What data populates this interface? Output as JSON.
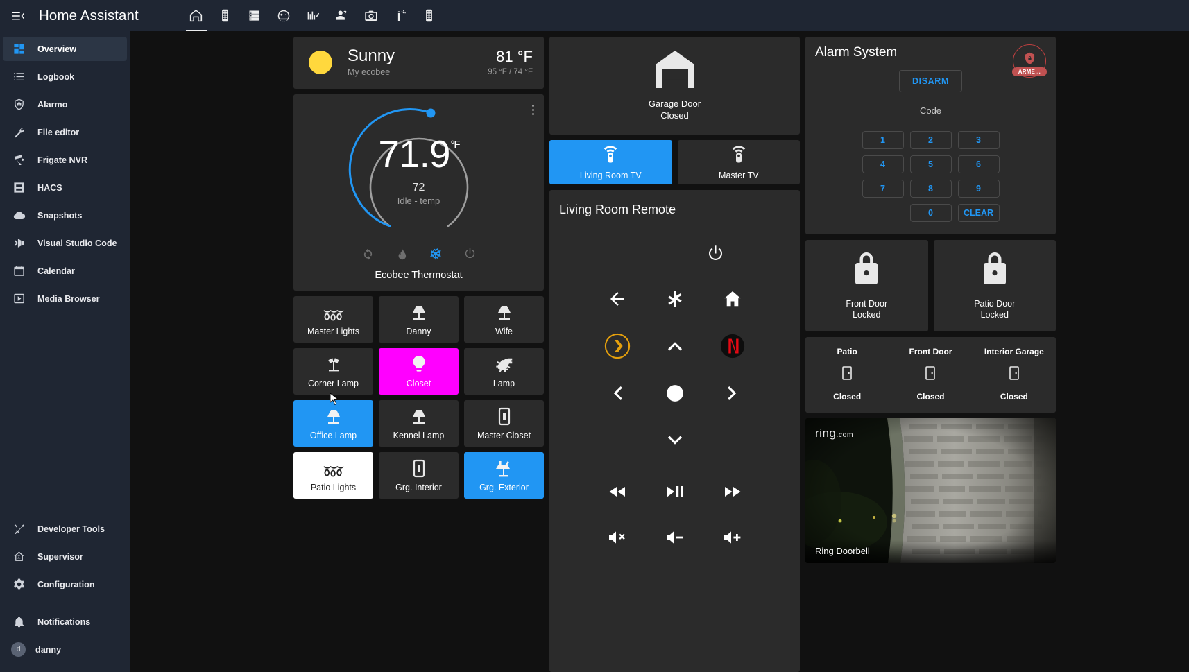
{
  "app": {
    "title": "Home Assistant",
    "menu_icon": "menu-collapse-icon"
  },
  "tabs": [
    {
      "name": "home",
      "icon": "home-icon",
      "active": true
    },
    {
      "name": "remote",
      "icon": "remote-control-icon",
      "active": false
    },
    {
      "name": "server",
      "icon": "server-rack-icon",
      "active": false
    },
    {
      "name": "robot",
      "icon": "robot-vacuum-icon",
      "active": false
    },
    {
      "name": "history",
      "icon": "chart-timeline-icon",
      "active": false
    },
    {
      "name": "presence",
      "icon": "account-question-icon",
      "active": false
    },
    {
      "name": "cameras",
      "icon": "camera-icon",
      "active": false
    },
    {
      "name": "sensors",
      "icon": "antenna-signal-icon",
      "active": false
    },
    {
      "name": "devices",
      "icon": "remote-control-icon",
      "active": false
    }
  ],
  "sidebar": {
    "items": [
      {
        "label": "Overview",
        "icon": "view-dashboard-icon",
        "active": true
      },
      {
        "label": "Logbook",
        "icon": "format-list-icon",
        "active": false
      },
      {
        "label": "Alarmo",
        "icon": "shield-home-icon",
        "active": false
      },
      {
        "label": "File editor",
        "icon": "wrench-icon",
        "active": false
      },
      {
        "label": "Frigate NVR",
        "icon": "cctv-icon",
        "active": false
      },
      {
        "label": "HACS",
        "icon": "hacs-icon",
        "active": false
      },
      {
        "label": "Snapshots",
        "icon": "cloud-icon",
        "active": false
      },
      {
        "label": "Visual Studio Code",
        "icon": "vscode-icon",
        "active": false
      },
      {
        "label": "Calendar",
        "icon": "calendar-icon",
        "active": false
      },
      {
        "label": "Media Browser",
        "icon": "play-box-icon",
        "active": false
      }
    ],
    "bottom_items": [
      {
        "label": "Developer Tools",
        "icon": "hammer-wrench-icon"
      },
      {
        "label": "Supervisor",
        "icon": "home-assistant-icon"
      },
      {
        "label": "Configuration",
        "icon": "cog-icon"
      }
    ],
    "notifications": {
      "label": "Notifications",
      "icon": "bell-icon"
    },
    "user": {
      "label": "danny",
      "initial": "d"
    }
  },
  "weather": {
    "state": "Sunny",
    "name": "My ecobee",
    "temperature": "81 °F",
    "high_low": "95 °F / 74 °F",
    "icon": "sunny-icon"
  },
  "thermostat": {
    "current": "71.9",
    "unit": "°F",
    "target": "72",
    "status": "Idle - temp",
    "name": "Ecobee Thermostat",
    "dial_color": "#2196f3",
    "modes": [
      {
        "name": "auto",
        "icon": "autorenew-icon",
        "active": false
      },
      {
        "name": "heat",
        "icon": "fire-icon",
        "active": false
      },
      {
        "name": "cool",
        "icon": "snowflake-icon",
        "active": true
      },
      {
        "name": "off",
        "icon": "power-icon",
        "active": false
      }
    ]
  },
  "light_tiles": [
    {
      "label": "Master Lights",
      "icon": "string-lights-icon",
      "state": "off"
    },
    {
      "label": "Danny",
      "icon": "lamp-icon",
      "state": "off"
    },
    {
      "label": "Wife",
      "icon": "lamp-icon",
      "state": "off"
    },
    {
      "label": "Corner Lamp",
      "icon": "floor-lamp-dual-icon",
      "state": "off"
    },
    {
      "label": "Closet",
      "icon": "bulb-icon",
      "state": "on-magenta"
    },
    {
      "label": "Lamp",
      "icon": "dinosaur-icon",
      "state": "off"
    },
    {
      "label": "Office Lamp",
      "icon": "lamp-icon",
      "state": "on-blue"
    },
    {
      "label": "Kennel Lamp",
      "icon": "lamp-icon",
      "state": "off"
    },
    {
      "label": "Master Closet",
      "icon": "door-icon",
      "state": "off"
    },
    {
      "label": "Patio Lights",
      "icon": "string-lights-icon",
      "state": "on-white"
    },
    {
      "label": "Grg. Interior",
      "icon": "door-icon",
      "state": "off"
    },
    {
      "label": "Grg. Exterior",
      "icon": "outdoor-lamp-icon",
      "state": "on-blue"
    }
  ],
  "garage": {
    "name": "Garage Door",
    "state": "Closed",
    "icon": "garage-icon"
  },
  "tv_tiles": [
    {
      "label": "Living Room TV",
      "icon": "remote-control-icon",
      "state": "on"
    },
    {
      "label": "Master TV",
      "icon": "remote-control-icon",
      "state": "off"
    }
  ],
  "remote": {
    "title": "Living Room Remote",
    "power": {
      "name": "power",
      "icon": "power-icon"
    },
    "rows": [
      [
        {
          "name": "back",
          "icon": "arrow-left-icon"
        },
        {
          "name": "asterisk",
          "icon": "asterisk-icon"
        },
        {
          "name": "home",
          "icon": "home-icon"
        }
      ],
      [
        {
          "name": "plex",
          "icon": "plex-icon"
        },
        {
          "name": "up",
          "icon": "chevron-up-icon"
        },
        {
          "name": "netflix",
          "icon": "netflix-icon"
        }
      ],
      [
        {
          "name": "left",
          "icon": "chevron-left-icon"
        },
        {
          "name": "select",
          "icon": "circle-icon"
        },
        {
          "name": "right",
          "icon": "chevron-right-icon"
        }
      ],
      [
        {
          "name": "blank-left",
          "icon": "none"
        },
        {
          "name": "down",
          "icon": "chevron-down-icon"
        },
        {
          "name": "blank-right",
          "icon": "none"
        }
      ]
    ],
    "media_rows": [
      [
        {
          "name": "rewind",
          "icon": "rewind-icon"
        },
        {
          "name": "play-pause",
          "icon": "play-pause-icon"
        },
        {
          "name": "fast-forward",
          "icon": "fast-forward-icon"
        }
      ],
      [
        {
          "name": "mute",
          "icon": "volume-mute-icon"
        },
        {
          "name": "volume-down",
          "icon": "volume-minus-icon"
        },
        {
          "name": "volume-up",
          "icon": "volume-plus-icon"
        }
      ]
    ]
  },
  "alarm": {
    "title": "Alarm System",
    "badge_label": "ARME…",
    "badge_icon": "shield-lock-icon",
    "badge_color": "#c05151",
    "disarm_label": "DISARM",
    "code_label": "Code",
    "code_value": "",
    "keys": [
      "1",
      "2",
      "3",
      "4",
      "5",
      "6",
      "7",
      "8",
      "9",
      "0"
    ],
    "clear_label": "CLEAR"
  },
  "locks": [
    {
      "name": "Front Door",
      "state": "Locked",
      "icon": "lock-icon"
    },
    {
      "name": "Patio Door",
      "state": "Locked",
      "icon": "lock-icon"
    }
  ],
  "door_sensors": [
    {
      "name": "Patio",
      "state": "Closed",
      "icon": "door-closed-icon"
    },
    {
      "name": "Front Door",
      "state": "Closed",
      "icon": "door-closed-icon"
    },
    {
      "name": "Interior Garage",
      "state": "Closed",
      "icon": "door-closed-icon"
    }
  ],
  "camera": {
    "caption": "Ring Doorbell",
    "watermark": "ring",
    "watermark_suffix": ".com"
  }
}
